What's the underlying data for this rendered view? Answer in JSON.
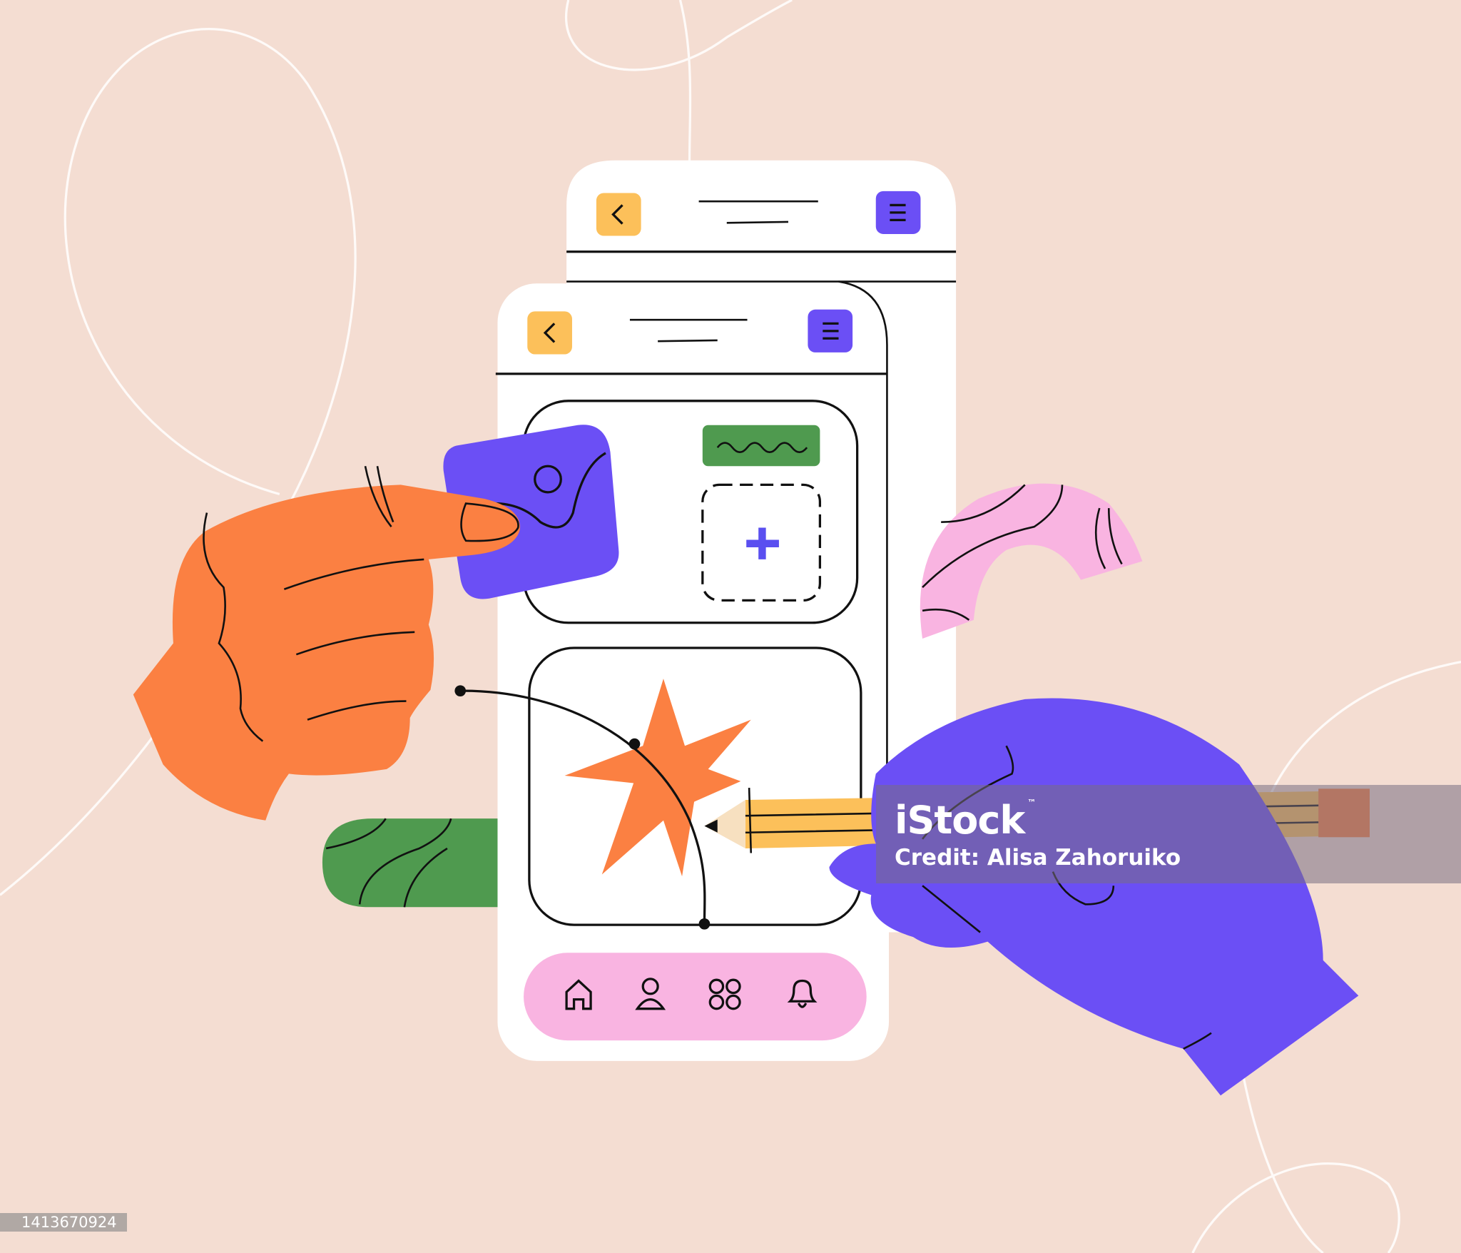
{
  "illustration": {
    "colors": {
      "background": "#f4ddd2",
      "orange": "#fb8042",
      "purple": "#6b4ff5",
      "yellow": "#fcc05a",
      "green": "#4f9a4f",
      "pink": "#f9b4e1",
      "outline": "#111111"
    },
    "phone": {
      "header_icons": [
        "back-chevron-icon",
        "menu-icon"
      ],
      "nav_icons": [
        "home-icon",
        "user-icon",
        "apps-grid-icon",
        "bell-icon"
      ]
    }
  },
  "watermark": {
    "brand": "iStock",
    "trademark": "™",
    "credit": "Credit: Alisa Zahoruiko"
  },
  "image_id": "1413670924"
}
